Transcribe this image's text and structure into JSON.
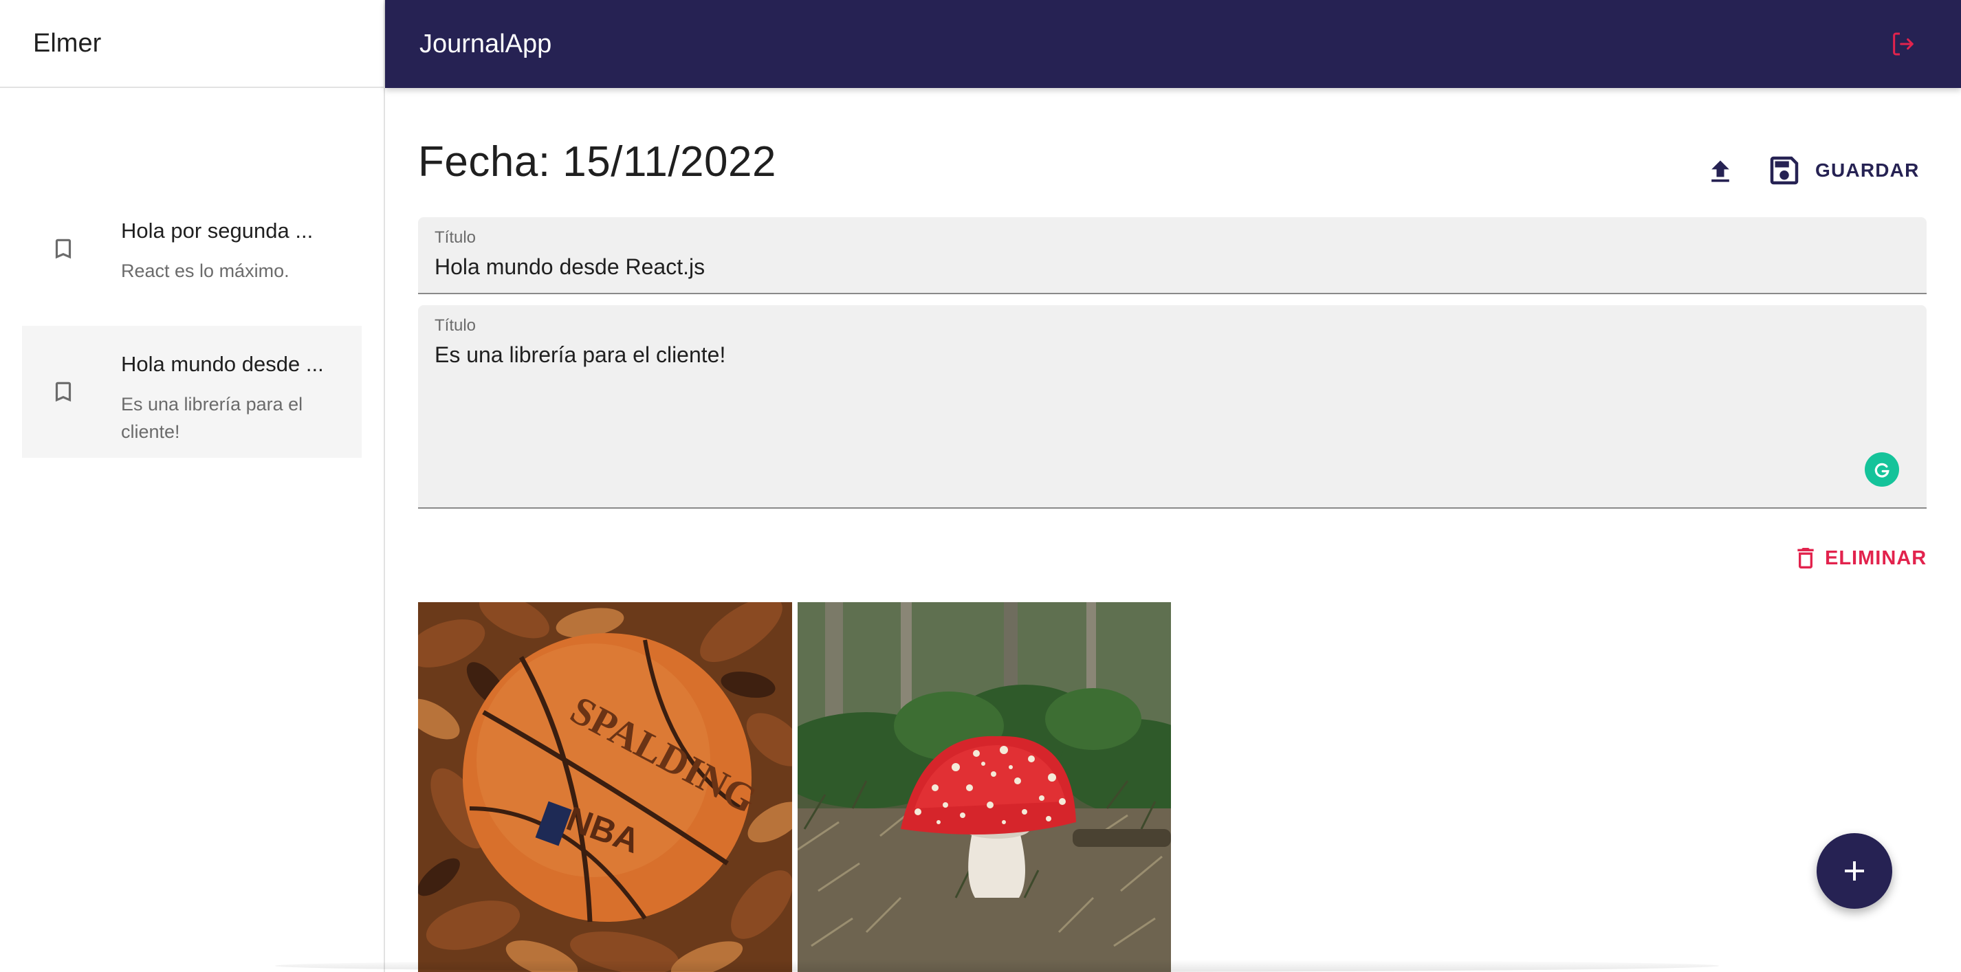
{
  "sidebar": {
    "user_name": "Elmer",
    "entries": [
      {
        "title": "Hola por segunda ...",
        "body": "React es lo máximo.",
        "icon": "bookmark-icon",
        "selected": false
      },
      {
        "title": "Hola mundo desde ...",
        "body": "Es una librería para el cliente!",
        "icon": "bookmark-icon",
        "selected": true
      }
    ]
  },
  "topbar": {
    "title": "JournalApp",
    "logout_icon": "logout-icon",
    "background": "#262253",
    "logout_color": "#e2234d"
  },
  "note": {
    "date_label": "Fecha: 15/11/2022",
    "upload_icon": "upload-icon",
    "save_label": "GUARDAR",
    "title_field": {
      "label": "Título",
      "value": "Hola mundo desde React.js"
    },
    "body_field": {
      "label": "Título",
      "value": "Es una librería para el cliente!"
    },
    "delete_label": "ELIMINAR",
    "images": [
      {
        "subject": "basketball-on-leaves"
      },
      {
        "subject": "red-mushroom-in-forest"
      }
    ]
  },
  "fab": {
    "icon": "plus-icon"
  },
  "colors": {
    "primary": "#262253",
    "error": "#e2234d",
    "field_bg": "#f0f0f0",
    "grammarly": "#15c39a"
  }
}
